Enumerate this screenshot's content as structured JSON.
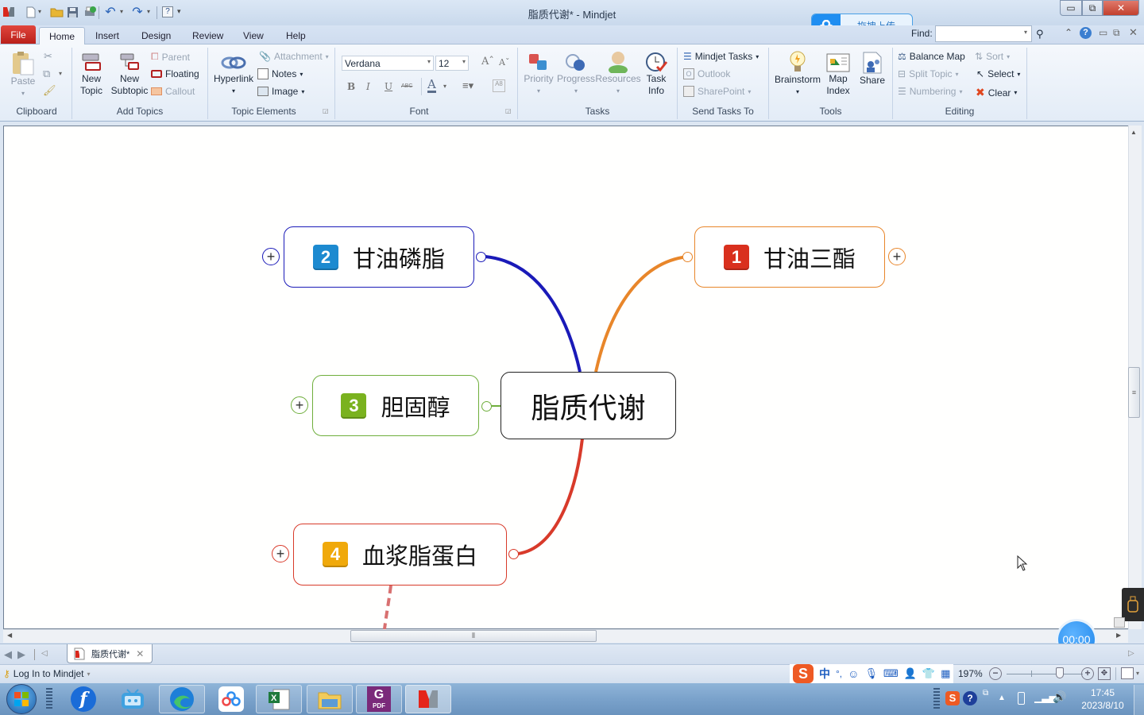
{
  "window": {
    "title": "脂质代谢* - Mindjet",
    "cloud_upload_label": "拖拽上传",
    "find_label": "Find:",
    "find_value": ""
  },
  "quick_access": {
    "icons": [
      "mindjet-logo-icon",
      "new-file-icon",
      "open-folder-icon",
      "save-icon",
      "print-icon",
      "undo-icon",
      "redo-icon",
      "help-icon",
      "customize-icon"
    ]
  },
  "ribbon_tabs": {
    "file": "File",
    "tabs": [
      "Home",
      "Insert",
      "Design",
      "Review",
      "View",
      "Help"
    ],
    "active": "Home"
  },
  "ribbon": {
    "clipboard": {
      "label": "Clipboard",
      "paste": "Paste"
    },
    "add_topics": {
      "label": "Add Topics",
      "new_topic": "New\nTopic",
      "new_subtopic": "New\nSubtopic",
      "parent": "Parent",
      "floating": "Floating",
      "callout": "Callout"
    },
    "topic_elements": {
      "label": "Topic Elements",
      "hyperlink": "Hyperlink",
      "attachment": "Attachment",
      "notes": "Notes",
      "image": "Image"
    },
    "font": {
      "label": "Font",
      "family": "Verdana",
      "size": "12",
      "bold": "B",
      "italic": "I",
      "underline": "U",
      "strike": "ABC"
    },
    "tasks": {
      "label": "Tasks",
      "priority": "Priority",
      "progress": "Progress",
      "resources": "Resources",
      "task_info": "Task\nInfo"
    },
    "send_tasks": {
      "label": "Send Tasks To",
      "mindjet_tasks": "Mindjet Tasks",
      "outlook": "Outlook",
      "sharepoint": "SharePoint"
    },
    "tools": {
      "label": "Tools",
      "brainstorm": "Brainstorm",
      "map_index": "Map\nIndex",
      "share": "Share"
    },
    "editing": {
      "label": "Editing",
      "balance_map": "Balance Map",
      "sort": "Sort",
      "split_topic": "Split Topic",
      "select": "Select",
      "numbering": "Numbering",
      "clear": "Clear"
    }
  },
  "mindmap": {
    "central": {
      "label": "脂质代谢"
    },
    "topics": [
      {
        "number": "1",
        "label": "甘油三酯",
        "color": "#e8862a",
        "badge_color": "#d9301e"
      },
      {
        "number": "2",
        "label": "甘油磷脂",
        "color": "#1a1ab8",
        "badge_color": "#1d8ad0"
      },
      {
        "number": "3",
        "label": "胆固醇",
        "color": "#6fae3c",
        "badge_color": "#7ab21f"
      },
      {
        "number": "4",
        "label": "血浆脂蛋白",
        "color": "#d83a2a",
        "badge_color": "#f0a90b"
      }
    ]
  },
  "doc_tabs": [
    {
      "label": "脂质代谢*",
      "active": true
    }
  ],
  "status": {
    "login": "Log In to Mindjet",
    "zoom": "197%",
    "zoom_level_percent": 197,
    "timer": "00:00",
    "ime_label": "中"
  },
  "taskbar": {
    "apps": [
      "start",
      "flash",
      "bilibili",
      "edge",
      "baidu-netdisk",
      "excel",
      "file-explorer",
      "foxit-pdf",
      "mindjet"
    ],
    "time": "17:45",
    "date": "2023/8/10"
  }
}
